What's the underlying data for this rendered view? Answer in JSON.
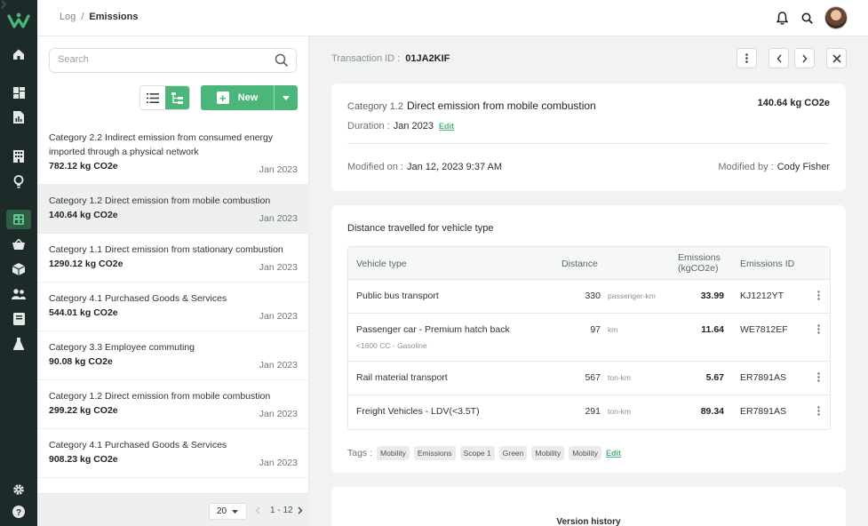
{
  "breadcrumb": {
    "root": "Log",
    "separator": "/",
    "current": "Emissions"
  },
  "search": {
    "placeholder": "Search",
    "value": ""
  },
  "list_actions": {
    "new_label": "New"
  },
  "list": [
    {
      "title": "Category 2.2 Indirect emission from consumed energy imported through a physical network",
      "amount": "782.12 kg CO2e",
      "date": "Jan 2023"
    },
    {
      "title": "Category 1.2 Direct emission from mobile combustion",
      "amount": "140.64 kg CO2e",
      "date": "Jan 2023",
      "selected": true
    },
    {
      "title": "Category 1.1 Direct emission from stationary combustion",
      "amount": "1290.12 kg CO2e",
      "date": "Jan 2023"
    },
    {
      "title": "Category 4.1 Purchased Goods & Services",
      "amount": "544.01 kg CO2e",
      "date": "Jan 2023"
    },
    {
      "title": "Category 3.3 Employee commuting",
      "amount": "90.08 kg CO2e",
      "date": "Jan 2023"
    },
    {
      "title": "Category 1.2 Direct emission from mobile combustion",
      "amount": "299.22 kg CO2e",
      "date": "Jan 2023"
    },
    {
      "title": "Category 4.1 Purchased Goods & Services",
      "amount": "908.23 kg CO2e",
      "date": "Jan 2023"
    }
  ],
  "pager": {
    "page_size": "20",
    "range": "1 - 12"
  },
  "transaction": {
    "label": "Transaction ID :",
    "id": "01JA2KIF"
  },
  "summary": {
    "category_code": "Category 1.2",
    "category_name": "Direct emission from mobile combustion",
    "amount": "140.64 kg CO2e",
    "duration_label": "Duration :",
    "duration": "Jan 2023",
    "edit_label": "Edit",
    "modified_on_label": "Modified on :",
    "modified_on": "Jan 12, 2023 9:37 AM",
    "modified_by_label": "Modified by :",
    "modified_by": "Cody Fisher"
  },
  "vehicles": {
    "title": "Distance travelled for vehicle type",
    "headers": {
      "vehicle_type": "Vehicle type",
      "distance": "Distance",
      "emissions": "Emissions (kgCO2e)",
      "emissions_id": "Emissions ID"
    },
    "rows": [
      {
        "vehicle_type": "Public bus transport",
        "sub": "",
        "distance": "330",
        "unit": "passenger-km",
        "emissions": "33.99",
        "emissions_id": "KJ1212YT"
      },
      {
        "vehicle_type": "Passenger car - Premium hatch back",
        "sub": "<1600 CC - Gasoline",
        "distance": "97",
        "unit": "km",
        "emissions": "11.64",
        "emissions_id": "WE7812EF"
      },
      {
        "vehicle_type": "Rail material transport",
        "sub": "",
        "distance": "567",
        "unit": "ton-km",
        "emissions": "5.67",
        "emissions_id": "ER7891AS"
      },
      {
        "vehicle_type": "Freight Vehicles - LDV(<3.5T)",
        "sub": "",
        "distance": "291",
        "unit": "ton-km",
        "emissions": "89.34",
        "emissions_id": "ER7891AS"
      }
    ],
    "tags_label": "Tags :",
    "tags": [
      "Mobility",
      "Emissions",
      "Scope 1",
      "Green",
      "Mobility",
      "Mobility"
    ],
    "tags_edit": "Edit"
  },
  "version_history": {
    "title": "Version history"
  },
  "colors": {
    "accent": "#4cb67a",
    "rail": "#1d2a2a",
    "rail_active": "#2f5d43"
  },
  "icons": {
    "rail": [
      "logo-icon",
      "home-icon",
      "dashboard-icon",
      "report-icon",
      "building-icon",
      "lightbulb-icon",
      "calculator-icon",
      "basket-icon",
      "box-icon",
      "users-icon",
      "book-icon",
      "flask-icon",
      "settings-icon",
      "help-icon",
      "expand-icon"
    ],
    "top": [
      "bell-icon",
      "search-icon",
      "avatar"
    ]
  }
}
